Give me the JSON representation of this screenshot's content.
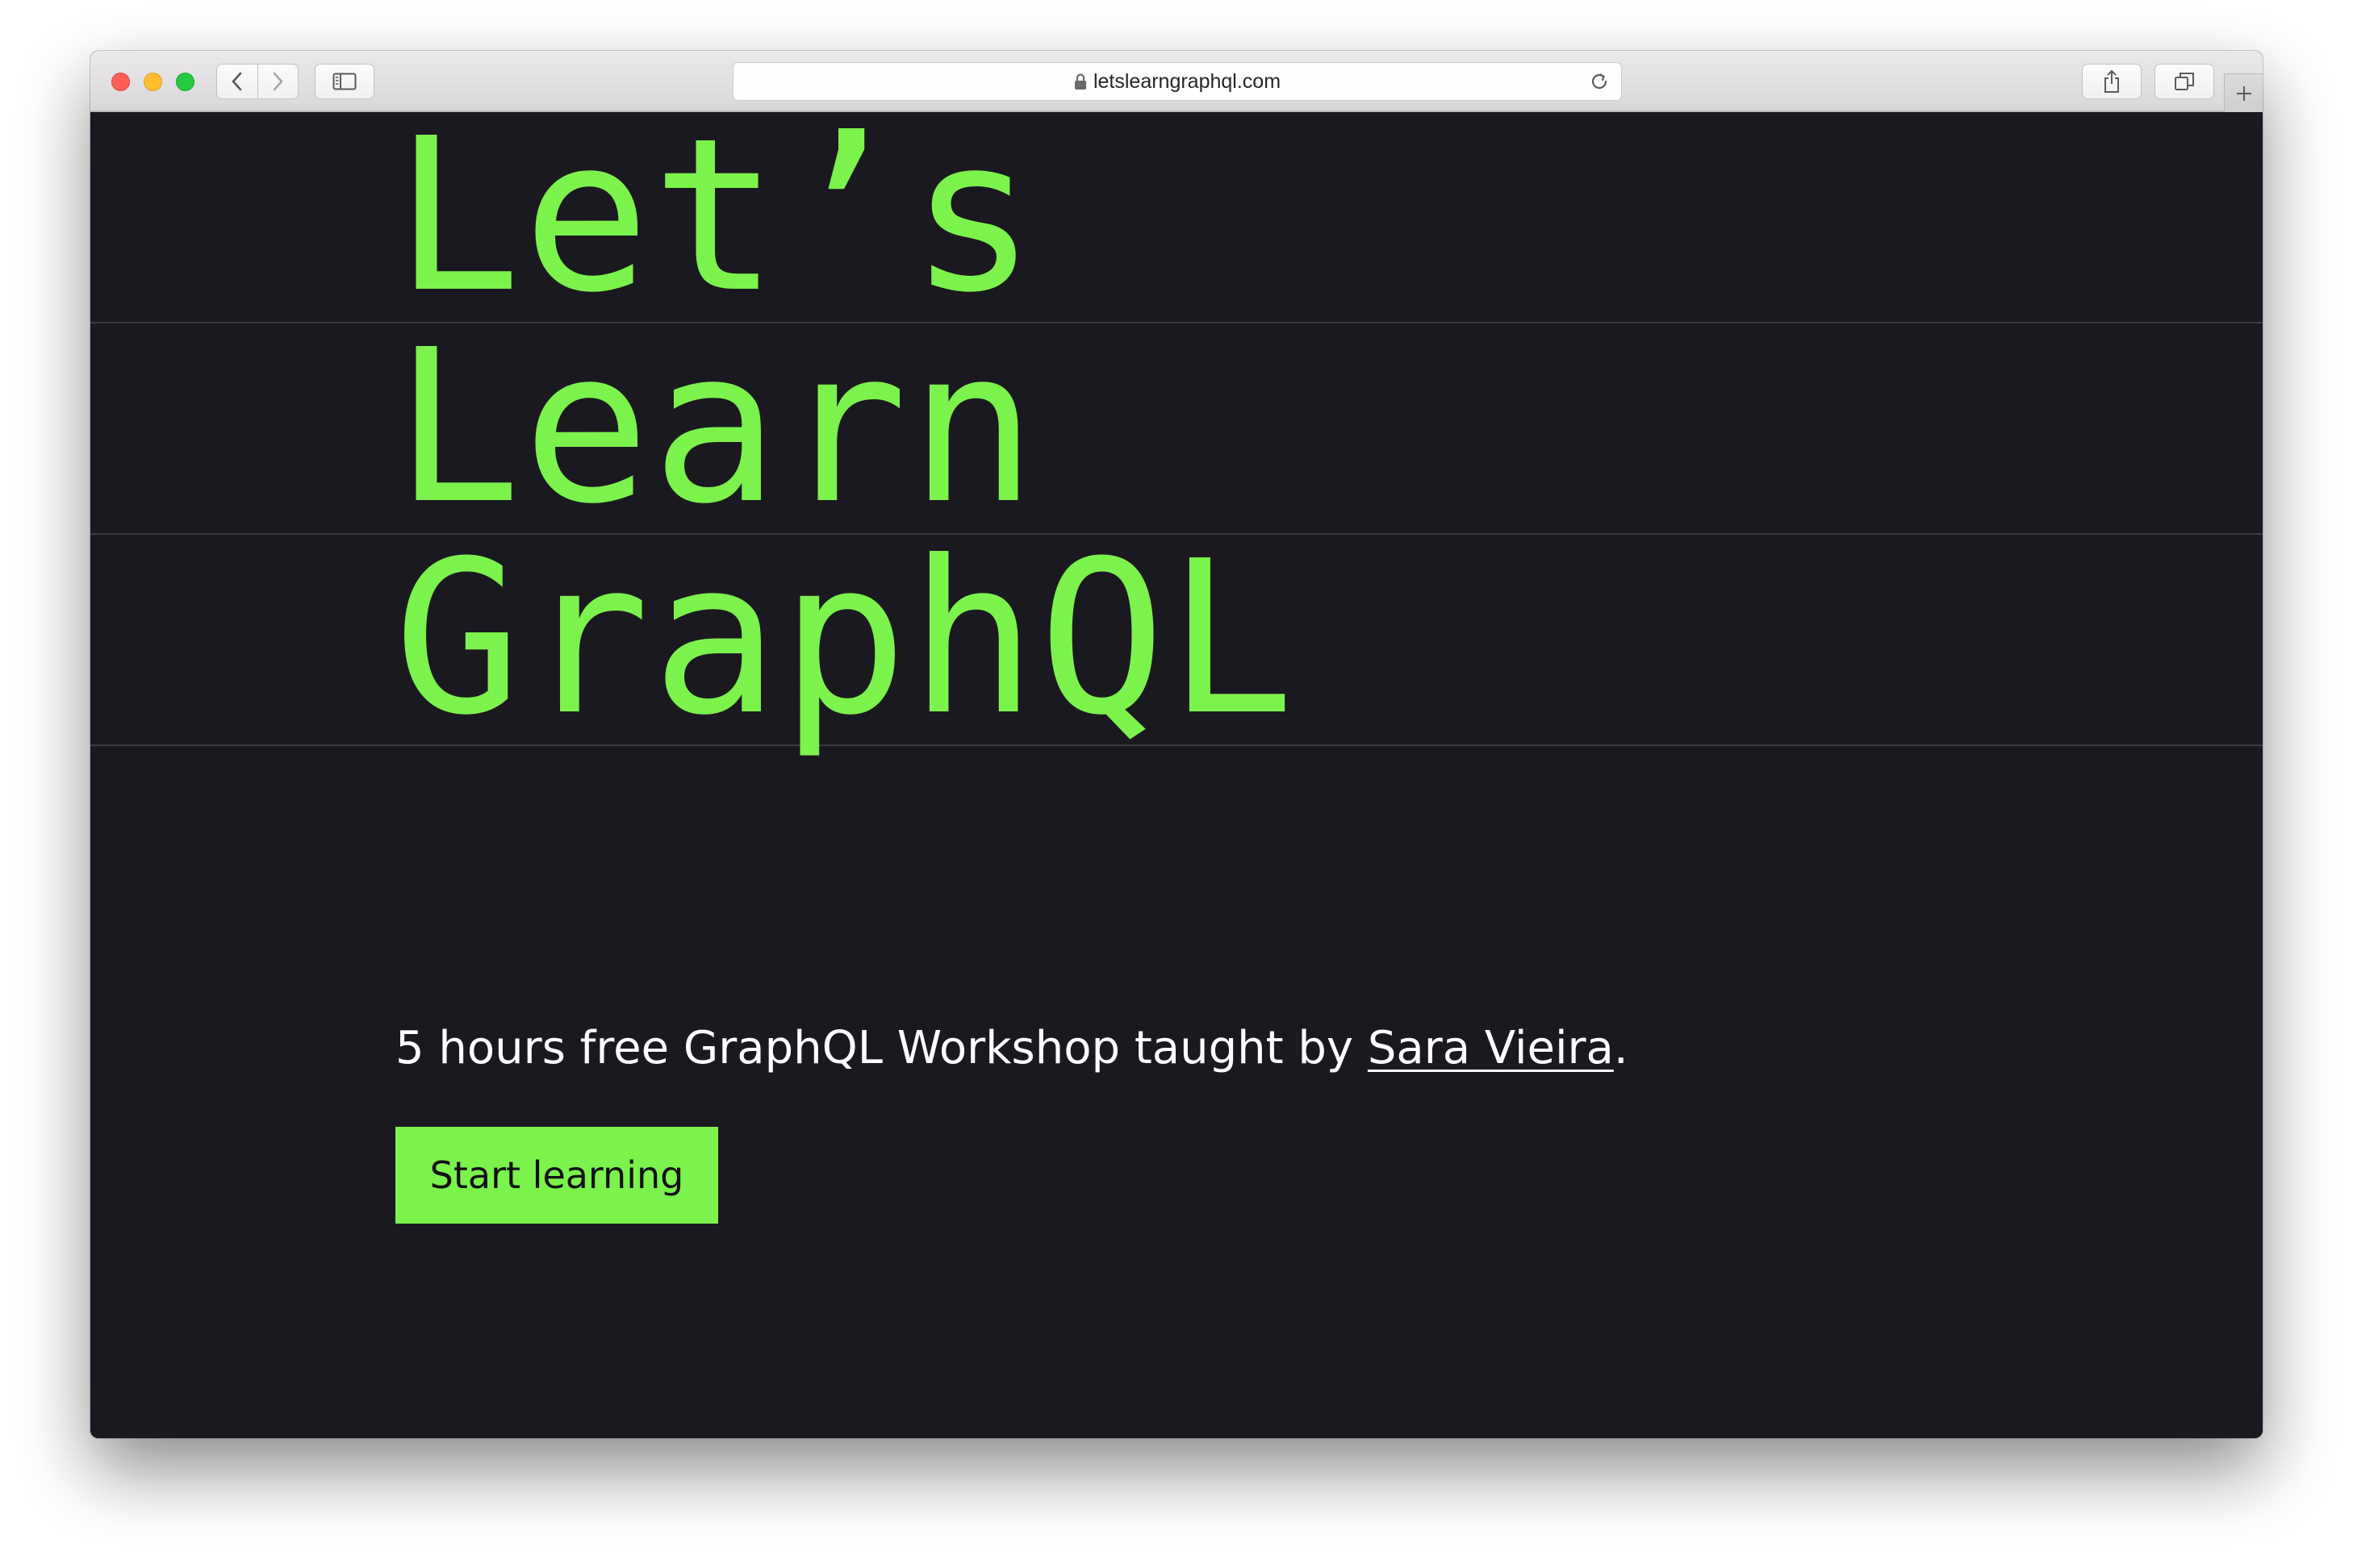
{
  "browser": {
    "url": "letslearngraphql.com"
  },
  "hero": {
    "lines": [
      "Let’s",
      "Learn",
      "GraphQL"
    ]
  },
  "intro": {
    "prefix": "5 hours free GraphQL Workshop taught by ",
    "author_link": "Sara Vieira",
    "suffix": "."
  },
  "cta": {
    "label": "Start learning"
  },
  "colors": {
    "background": "#1b1920",
    "accent": "#7cf24d",
    "text": "#ffffff"
  },
  "icons": {
    "back": "chevron-left-icon",
    "forward": "chevron-right-icon",
    "sidebar": "sidebar-icon",
    "lock": "lock-icon",
    "reload": "reload-icon",
    "share": "share-icon",
    "tabs": "tabs-overview-icon",
    "new_tab": "plus-icon"
  }
}
